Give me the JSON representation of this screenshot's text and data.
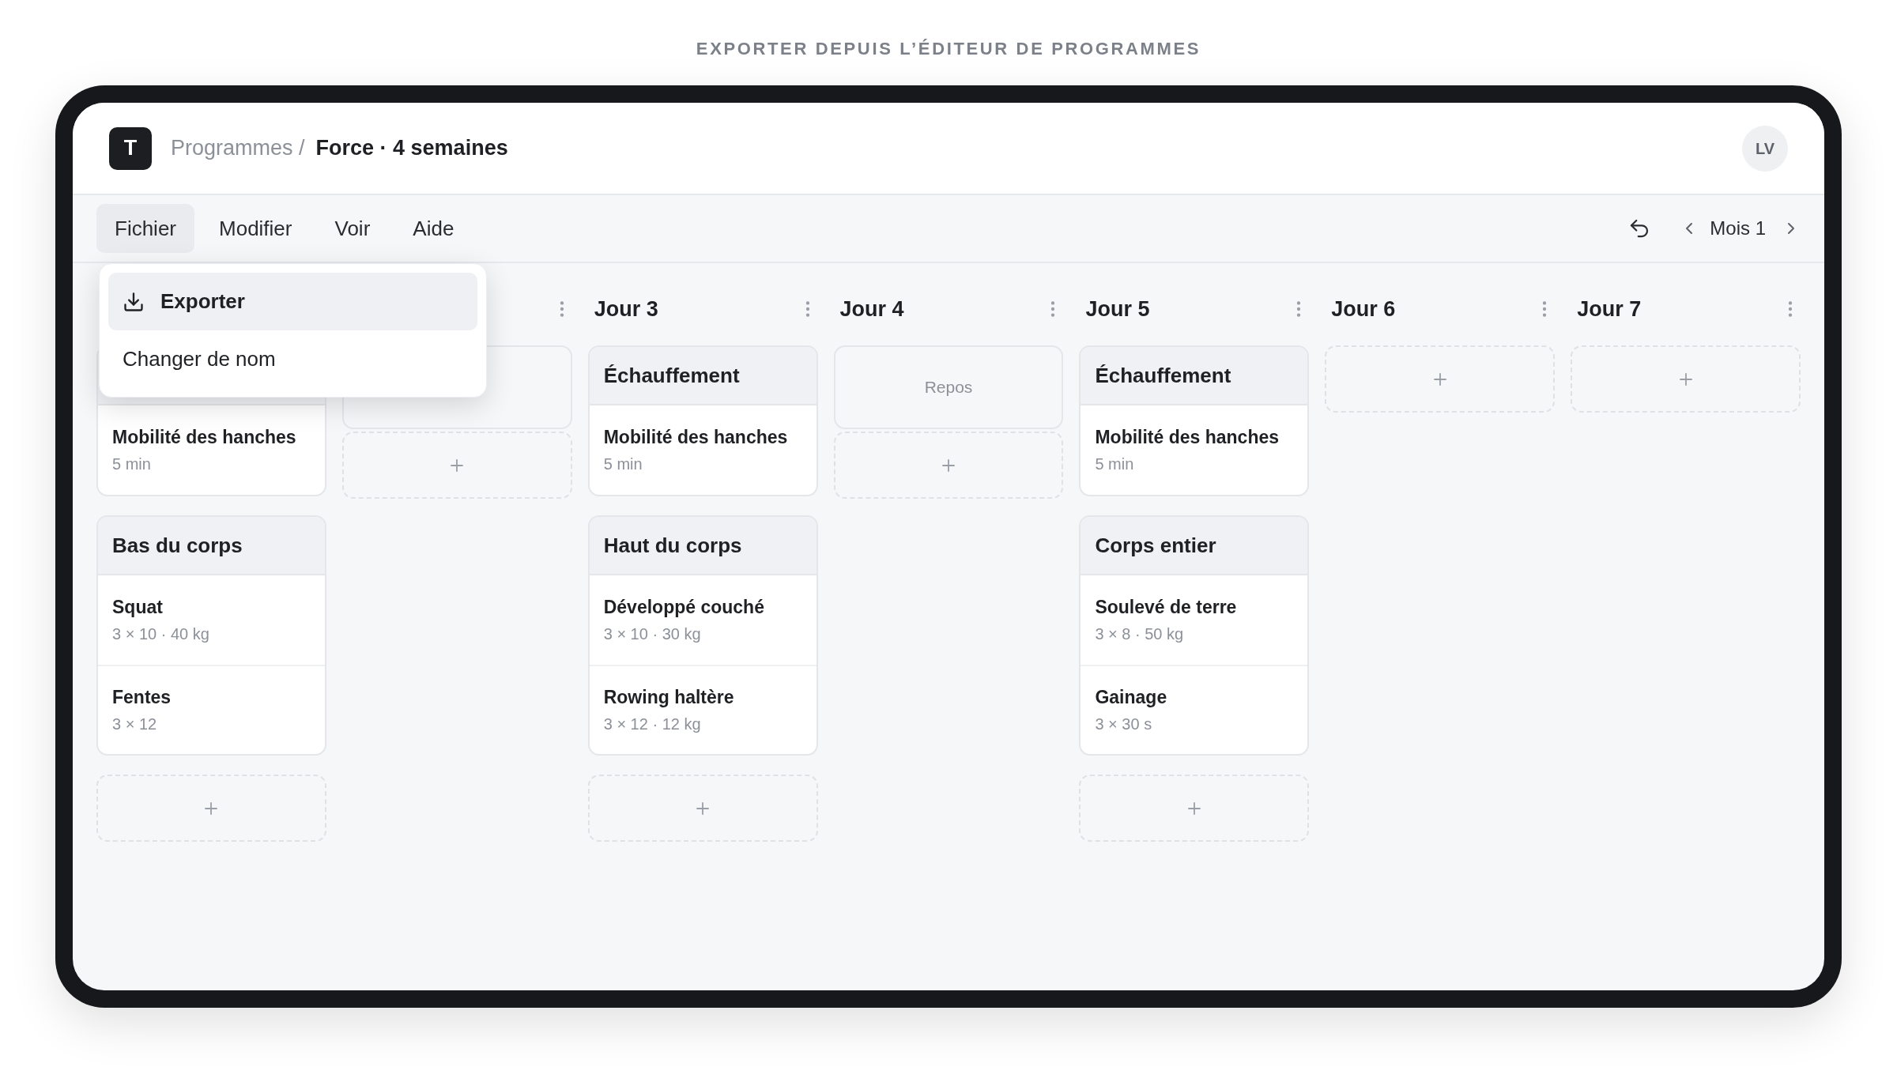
{
  "caption": "EXPORTER DEPUIS L’ÉDITEUR DE PROGRAMMES",
  "header": {
    "logo": "T",
    "breadcrumb_parent": "Programmes /",
    "breadcrumb_current": "Force · 4 semaines",
    "avatar": "LV"
  },
  "menu": [
    {
      "label": "Fichier",
      "selected": true
    },
    {
      "label": "Modifier",
      "selected": false
    },
    {
      "label": "Voir",
      "selected": false
    },
    {
      "label": "Aide",
      "selected": false
    }
  ],
  "dropdown": {
    "items": [
      {
        "kind": "export",
        "label": "Exporter",
        "selected": true
      },
      {
        "kind": "rename",
        "label": "Changer de nom",
        "selected": false
      }
    ]
  },
  "period": {
    "label": "Mois 1"
  },
  "days": [
    {
      "blocks": [
        {
          "kind": "session",
          "exercises": [
            {
              "name": "Mobilité des hanches",
              "detail": "5 min"
            }
          ]
        },
        {
          "kind": "session",
          "title": "Bas du corps",
          "exercises": [
            {
              "name": "Squat",
              "detail": "3 × 10 · 40 kg"
            },
            {
              "name": "Fentes",
              "detail": "3 × 12"
            }
          ]
        },
        {
          "kind": "add"
        }
      ]
    },
    {
      "has_menu": true,
      "blocks": [
        {
          "kind": "rest"
        },
        {
          "kind": "add"
        }
      ]
    },
    {
      "title": "Jour 3",
      "has_menu": true,
      "blocks": [
        {
          "kind": "session",
          "title": "Échauffement",
          "exercises": [
            {
              "name": "Mobilité des hanches",
              "detail": "5 min"
            }
          ]
        },
        {
          "kind": "session",
          "title": "Haut du corps",
          "exercises": [
            {
              "name": "Développé couché",
              "detail": "3 × 10 · 30 kg"
            },
            {
              "name": "Rowing haltère",
              "detail": "3 × 12 · 12 kg"
            }
          ]
        },
        {
          "kind": "add"
        }
      ]
    },
    {
      "title": "Jour 4",
      "has_menu": true,
      "blocks": [
        {
          "kind": "rest",
          "label": "Repos"
        },
        {
          "kind": "add"
        }
      ]
    },
    {
      "title": "Jour 5",
      "has_menu": true,
      "blocks": [
        {
          "kind": "session",
          "title": "Échauffement",
          "exercises": [
            {
              "name": "Mobilité des hanches",
              "detail": "5 min"
            }
          ]
        },
        {
          "kind": "session",
          "title": "Corps entier",
          "exercises": [
            {
              "name": "Soulevé de terre",
              "detail": "3 × 8 · 50 kg"
            },
            {
              "name": "Gainage",
              "detail": "3 × 30 s"
            }
          ]
        },
        {
          "kind": "add"
        }
      ]
    },
    {
      "title": "Jour 6",
      "has_menu": true,
      "blocks": [
        {
          "kind": "add"
        }
      ]
    },
    {
      "title": "Jour 7",
      "has_menu": true,
      "blocks": [
        {
          "kind": "add"
        }
      ]
    }
  ]
}
